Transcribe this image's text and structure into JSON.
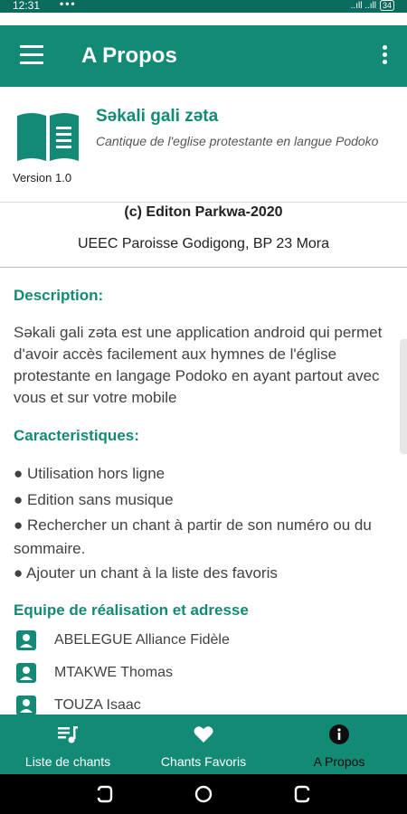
{
  "status_bar": {
    "time": "12:31",
    "dots": "•••",
    "signal": "..ıll ..ıll",
    "battery": "34"
  },
  "app_bar": {
    "title": "A Propos",
    "menu_icon": "hamburger-menu-icon",
    "overflow_icon": "more-vert-icon"
  },
  "header": {
    "icon": "book-icon",
    "app_name": "Səkali gali zəta",
    "subtitle": "Cantique de l'eglise protestante en langue Podoko",
    "version": "Version 1.0"
  },
  "copyright": "(c) Editon Parkwa-2020",
  "address": "UEEC Paroisse Godigong, BP 23 Mora",
  "description": {
    "heading": "Description:",
    "text": "Səkali gali zəta  est une application  android qui permet d'avoir accès facilement aux hymnes de l'église protestante en langage Podoko en ayant partout avec vous et sur votre mobile"
  },
  "features": {
    "heading": "Caracteristiques:",
    "items": [
      "● Utilisation hors ligne",
      "● Edition sans musique",
      "●  Rechercher un chant à partir de son numéro ou du sommaire.",
      "● Ajouter un chant à la liste des favoris"
    ]
  },
  "team": {
    "heading": "Equipe de réalisation et adresse",
    "members": [
      "ABELEGUE Alliance Fidèle",
      "MTAKWE Thomas",
      "TOUZA Isaac"
    ]
  },
  "bottom_nav": [
    {
      "label": "Liste de chants",
      "icon": "music-list-icon"
    },
    {
      "label": "Chants Favoris",
      "icon": "heart-icon"
    },
    {
      "label": "A Propos",
      "icon": "info-icon",
      "active": true
    }
  ],
  "colors": {
    "primary": "#138a76",
    "primary_dark": "#0b6b5c",
    "active_label": "#0d0d0d"
  }
}
